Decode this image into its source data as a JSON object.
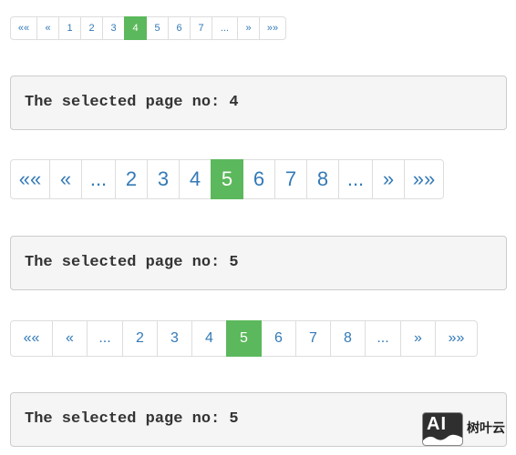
{
  "theme": {
    "link_color": "#337ab7",
    "active_color": "#5cb85c",
    "border_color": "#dddddd",
    "output_background": "#f5f5f5"
  },
  "paginations": [
    {
      "items": [
        {
          "label": "««"
        },
        {
          "label": "«"
        },
        {
          "label": "1"
        },
        {
          "label": "2"
        },
        {
          "label": "3"
        },
        {
          "label": "4",
          "active": true
        },
        {
          "label": "5"
        },
        {
          "label": "6"
        },
        {
          "label": "7"
        },
        {
          "label": "..."
        },
        {
          "label": "»"
        },
        {
          "label": "»»"
        }
      ]
    },
    {
      "items": [
        {
          "label": "««"
        },
        {
          "label": "«"
        },
        {
          "label": "..."
        },
        {
          "label": "2"
        },
        {
          "label": "3"
        },
        {
          "label": "4"
        },
        {
          "label": "5",
          "active": true
        },
        {
          "label": "6"
        },
        {
          "label": "7"
        },
        {
          "label": "8"
        },
        {
          "label": "..."
        },
        {
          "label": "»"
        },
        {
          "label": "»»"
        }
      ]
    },
    {
      "items": [
        {
          "label": "««"
        },
        {
          "label": "«"
        },
        {
          "label": "..."
        },
        {
          "label": "2"
        },
        {
          "label": "3"
        },
        {
          "label": "4"
        },
        {
          "label": "5",
          "active": true
        },
        {
          "label": "6"
        },
        {
          "label": "7"
        },
        {
          "label": "8"
        },
        {
          "label": "..."
        },
        {
          "label": "»"
        },
        {
          "label": "»»"
        }
      ]
    }
  ],
  "outputs": [
    "The selected page no: 4",
    "The selected page no: 5",
    "The selected page no: 5"
  ],
  "watermark": {
    "mark": "AI",
    "text": "树叶云"
  }
}
